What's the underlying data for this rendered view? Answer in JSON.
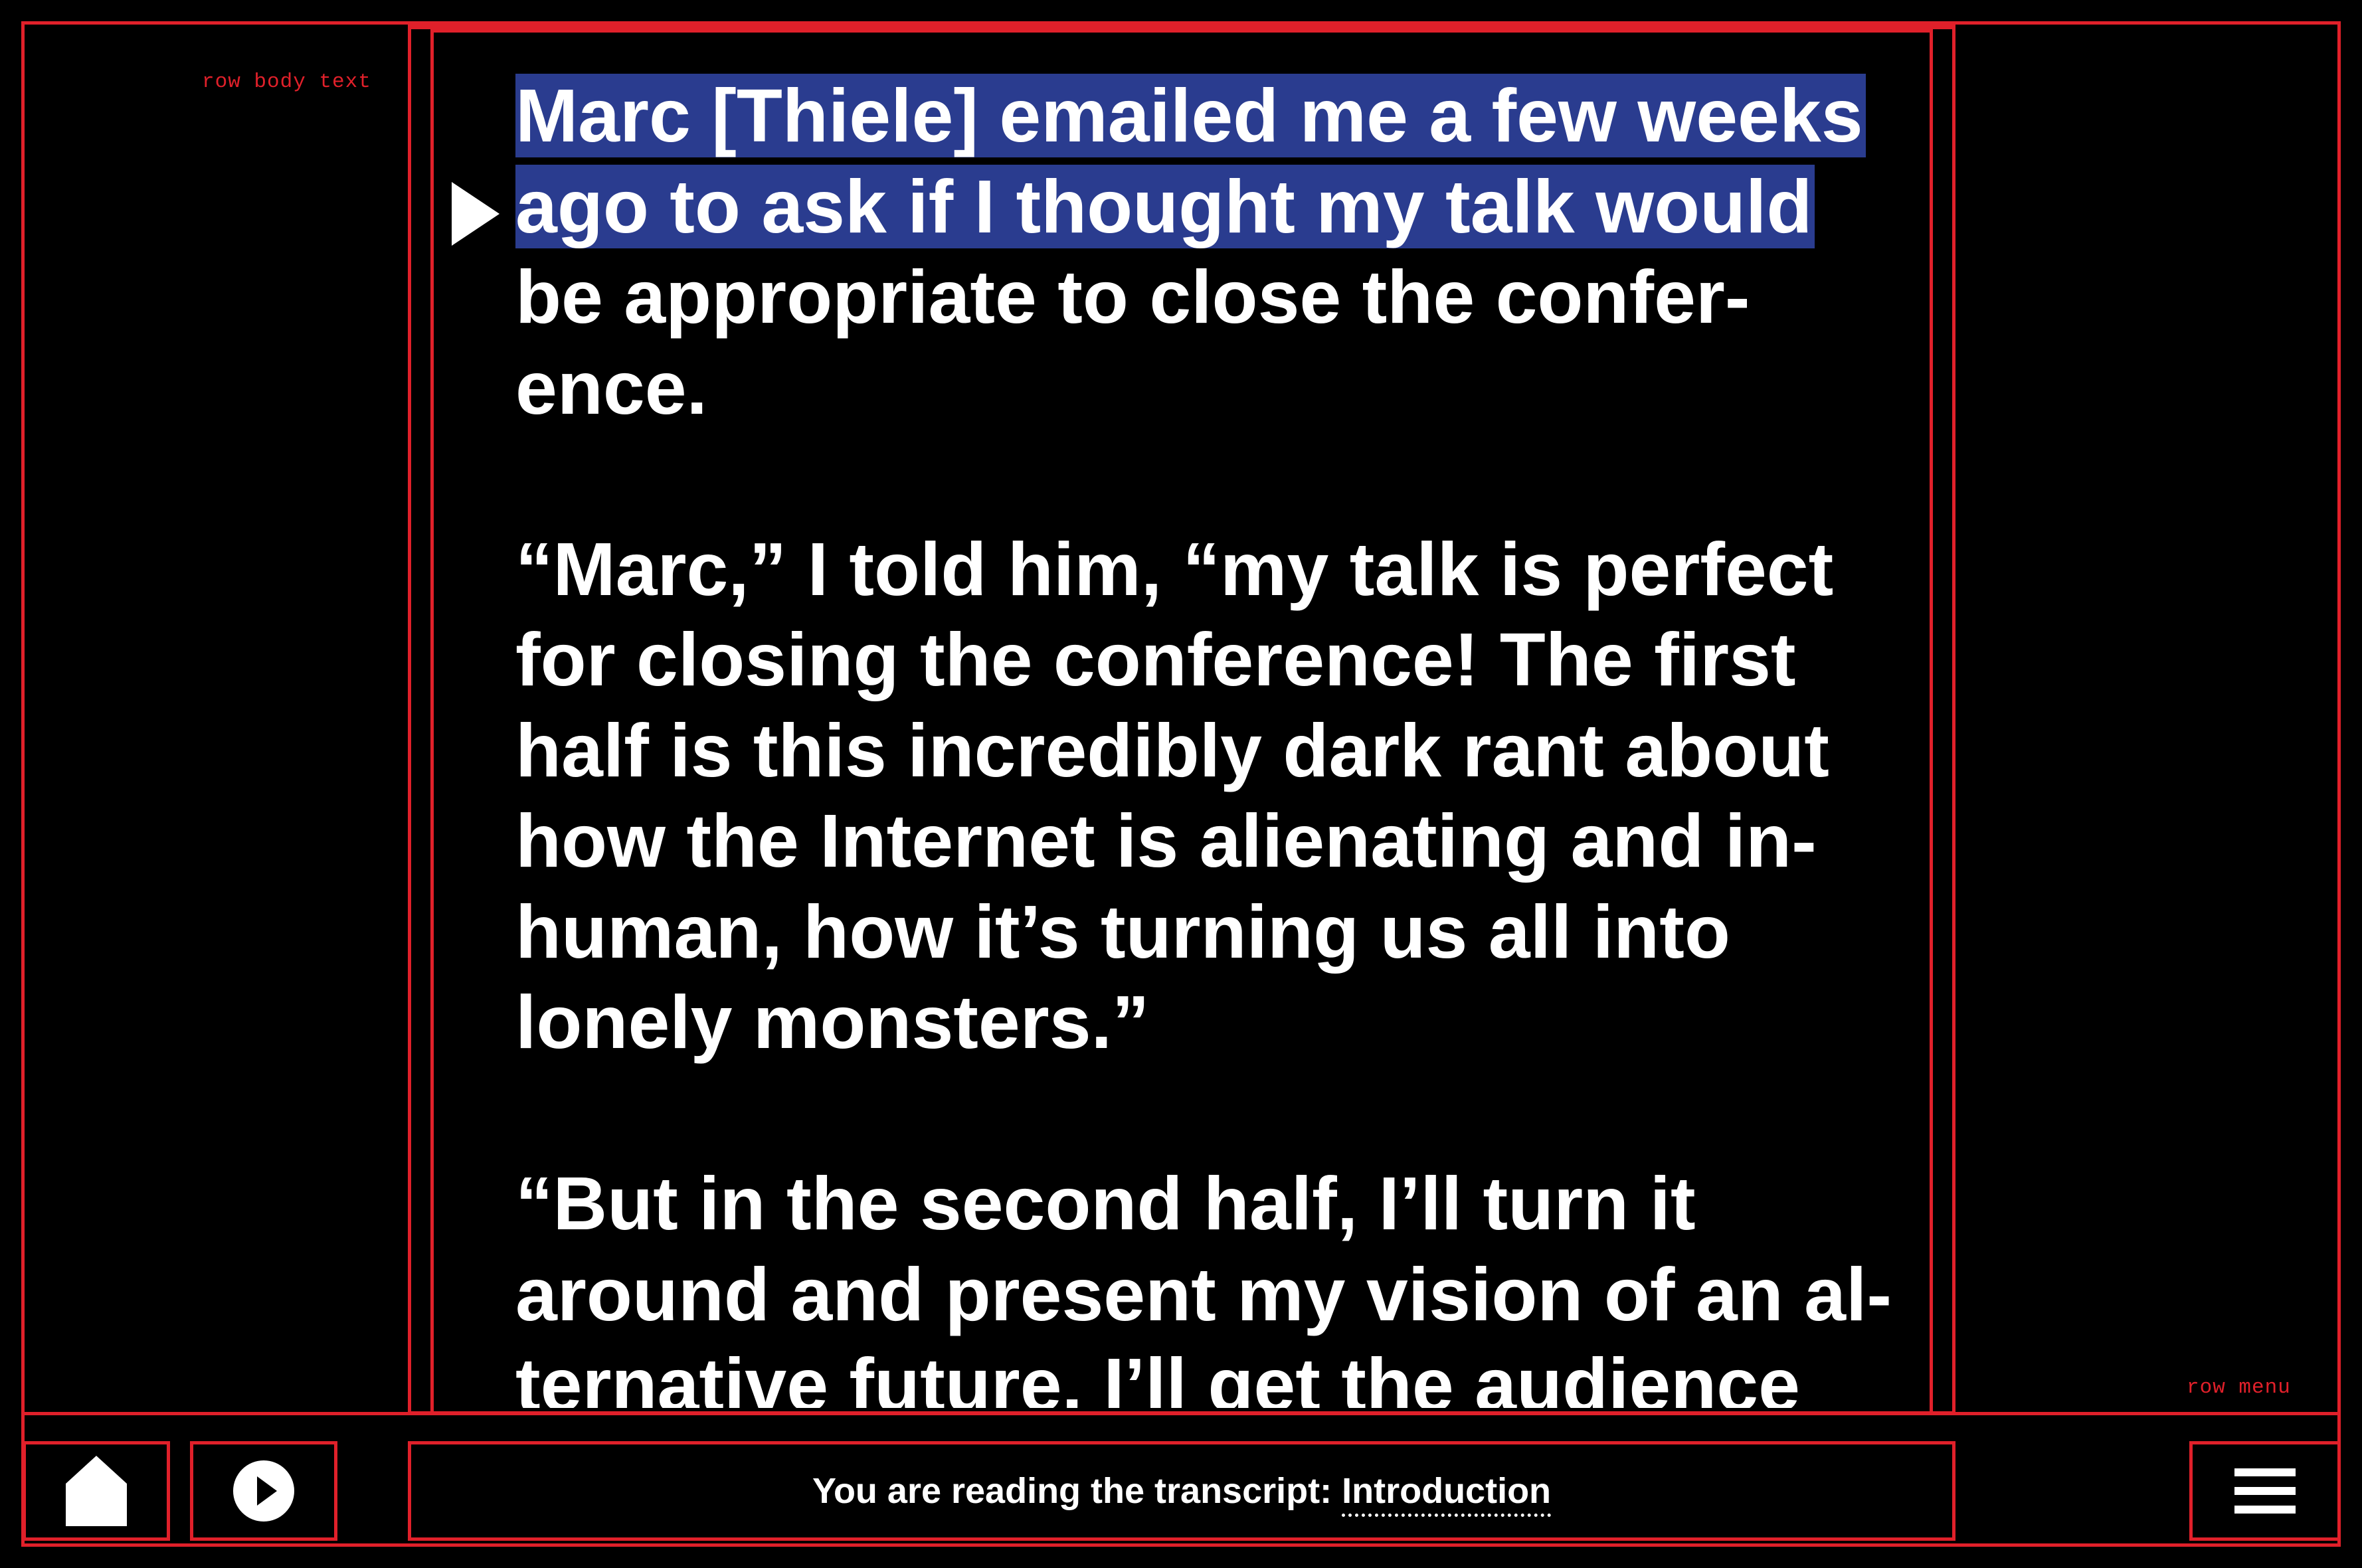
{
  "debug_labels": {
    "row_body": "row body text",
    "row_menu": "row menu"
  },
  "colors": {
    "frame": "#e0202a",
    "highlight": "#2a3c8f",
    "background": "#000000",
    "text": "#ffffff"
  },
  "transcript": {
    "paragraphs": [
      {
        "lines": [
          "Marc [Thiele] emailed me a few weeks",
          "ago to ask if I thought my talk would",
          "be appropriate to close the confer-",
          "ence."
        ]
      },
      {
        "lines": [
          "“Marc,” I told him, “my talk is perfect",
          "for closing the conference! The first",
          "half is this incredibly dark rant about",
          "how the Internet is alienating and in-",
          "human, how it’s turning us all into",
          "lonely monsters.”"
        ]
      },
      {
        "lines": [
          "“But in the second half, I’ll turn it",
          "around and present my vision of an al-",
          "ternative future. I’ll get the audience"
        ]
      }
    ]
  },
  "menu": {
    "home_icon": "home-icon",
    "play_icon": "play-icon",
    "menu_icon": "hamburger-menu-icon",
    "status_prefix": "You are reading the transcript:",
    "chapter": "Introduction"
  }
}
